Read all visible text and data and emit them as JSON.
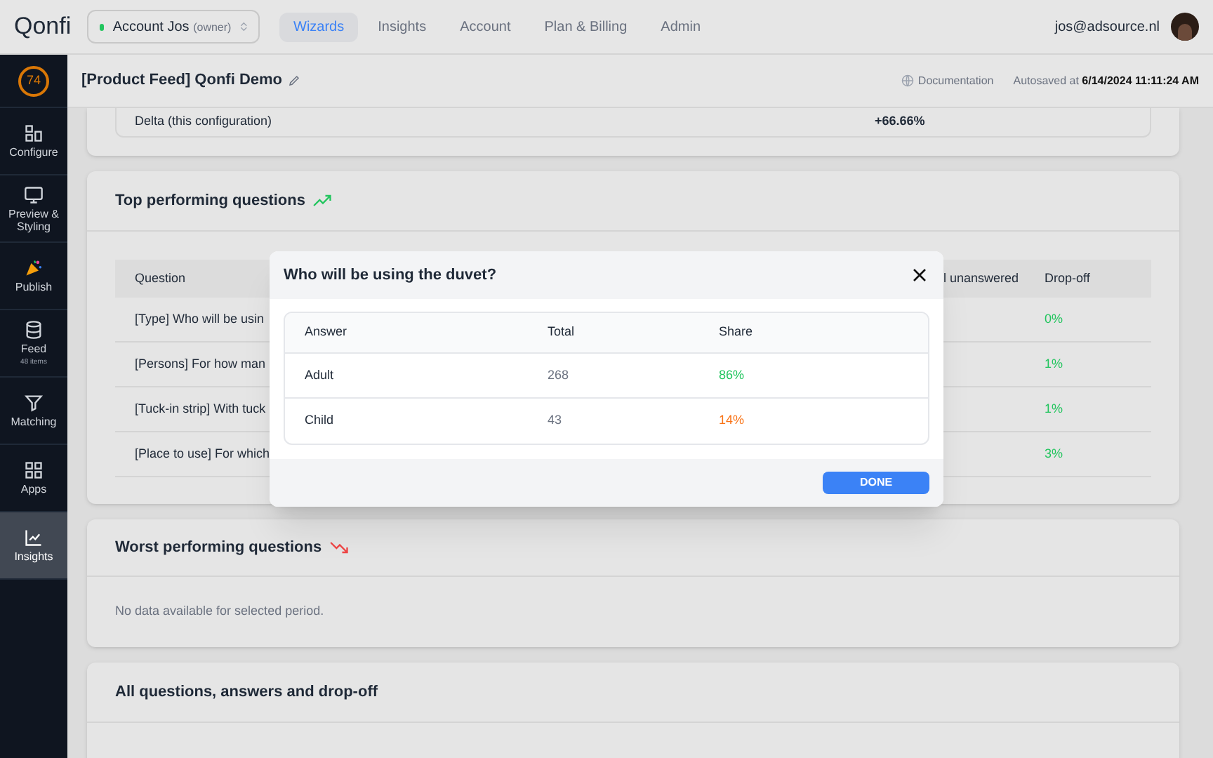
{
  "topbar": {
    "logo": "Qonfi",
    "account": {
      "name": "Account Jos",
      "role": "(owner)"
    },
    "nav": [
      {
        "label": "Wizards",
        "selected": true
      },
      {
        "label": "Insights",
        "selected": false
      },
      {
        "label": "Account",
        "selected": false
      },
      {
        "label": "Plan & Billing",
        "selected": false
      },
      {
        "label": "Admin",
        "selected": false
      }
    ],
    "user_email": "jos@adsource.nl"
  },
  "sidebar": {
    "score": "74",
    "items": [
      {
        "label": "Configure",
        "selected": false
      },
      {
        "label": "Preview & Styling",
        "selected": false
      },
      {
        "label": "Publish",
        "selected": false
      },
      {
        "label": "Feed",
        "sub": "48 items",
        "selected": false
      },
      {
        "label": "Matching",
        "selected": false
      },
      {
        "label": "Apps",
        "selected": false
      },
      {
        "label": "Insights",
        "selected": true
      }
    ]
  },
  "subheader": {
    "title": "[Product Feed] Qonfi Demo",
    "documentation": "Documentation",
    "autosaved_label": "Autosaved at",
    "autosaved_time": "6/14/2024 11:11:24 AM"
  },
  "delta_row": {
    "label": "Delta (this configuration)",
    "value": "+66.66%"
  },
  "top_questions": {
    "title": "Top performing questions",
    "columns": [
      "Question",
      "l unanswered",
      "Drop-off"
    ],
    "rows": [
      {
        "question": "[Type] Who will be usin",
        "dropoff": "0%"
      },
      {
        "question": "[Persons] For how man",
        "dropoff": "1%"
      },
      {
        "question": "[Tuck-in strip] With tuck",
        "dropoff": "1%"
      },
      {
        "question": "[Place to use] For which",
        "dropoff": "3%"
      }
    ]
  },
  "worst_questions": {
    "title": "Worst performing questions",
    "empty_text": "No data available for selected period."
  },
  "all_questions": {
    "title": "All questions, answers and drop-off"
  },
  "dialog": {
    "title": "Who will be using the duvet?",
    "columns": [
      "Answer",
      "Total",
      "Share"
    ],
    "rows": [
      {
        "answer": "Adult",
        "total": "268",
        "share": "86%",
        "color": "#22c55e"
      },
      {
        "answer": "Child",
        "total": "43",
        "share": "14%",
        "color": "#f97316"
      }
    ],
    "done": "DONE"
  }
}
